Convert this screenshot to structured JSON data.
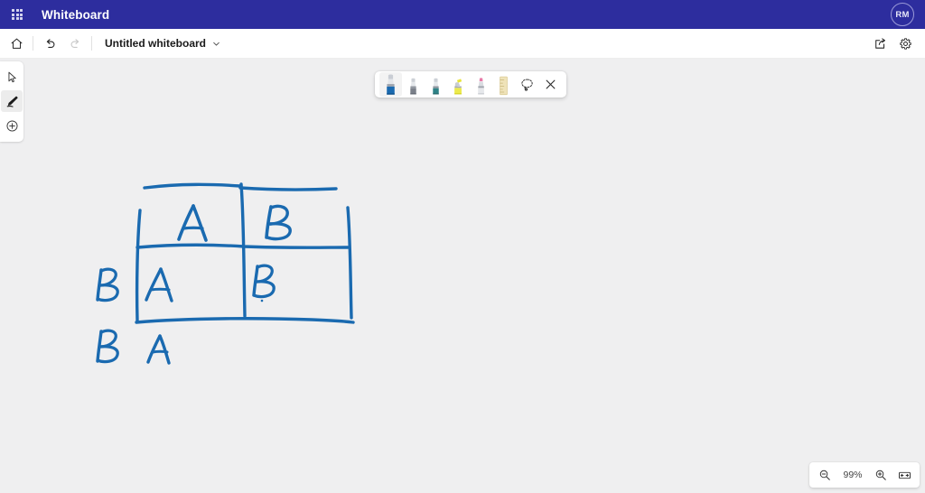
{
  "appbar": {
    "waffle_icon": "app-launcher-waffle-icon",
    "title": "Whiteboard",
    "avatar_initials": "RM"
  },
  "commandbar": {
    "home_icon": "home-icon",
    "undo_icon": "undo-arrow-icon",
    "redo_icon": "redo-arrow-icon",
    "document_title": "Untitled whiteboard",
    "title_chevron_icon": "chevron-down-icon",
    "share_icon": "share-icon",
    "settings_icon": "gear-icon"
  },
  "tool_rail": {
    "items": [
      {
        "name": "select-cursor-tool",
        "icon": "cursor-arrow-icon",
        "label": "Select",
        "active": false
      },
      {
        "name": "pen-tool",
        "icon": "pen-icon",
        "label": "Ink",
        "active": true
      },
      {
        "name": "add-content-tool",
        "icon": "plus-circle-icon",
        "label": "Create",
        "active": false
      }
    ]
  },
  "pen_toolbar": {
    "pens": [
      {
        "name": "pen-blue",
        "label": "Blue pen",
        "color": "#1a6ab0",
        "selected": true
      },
      {
        "name": "pen-gray",
        "label": "Gray pen",
        "color": "#6a6a78",
        "selected": false
      },
      {
        "name": "pen-teal",
        "label": "Teal pen",
        "color": "#2f7f82",
        "selected": false
      },
      {
        "name": "highlighter-yellow",
        "label": "Yellow highlighter",
        "color": "#e8e438",
        "selected": false
      },
      {
        "name": "highlighter-pink",
        "label": "Pink highlighter",
        "color": "#e87aa8",
        "selected": false
      }
    ],
    "ruler_icon": "ruler-icon",
    "ruler_label": "Ruler",
    "lasso_icon": "lasso-select-icon",
    "lasso_label": "Lasso select",
    "close_icon": "close-x-icon",
    "close_label": "Close"
  },
  "zoom_controls": {
    "zoom_out_icon": "zoom-out-magnifier-icon",
    "zoom_out_label": "Zoom out",
    "zoom_level": "99%",
    "zoom_in_icon": "zoom-in-magnifier-icon",
    "zoom_in_label": "Zoom in",
    "fit_icon": "fit-to-screen-icon",
    "fit_label": "Fit to screen"
  },
  "canvas": {
    "background_color": "#efeff0",
    "ink_color": "#1a6ab0",
    "drawing_description": "hand-drawn 2x2 punnett square grid",
    "annotations": {
      "column_headers": [
        "A",
        "B"
      ],
      "row_headers": [
        "B",
        "B"
      ],
      "cells": [
        [
          "A",
          "B"
        ],
        [
          "A",
          ""
        ]
      ]
    }
  }
}
